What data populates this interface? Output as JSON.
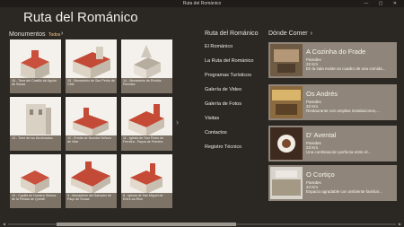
{
  "window": {
    "title": "Ruta del Románico",
    "controls": "— ▢ ✕"
  },
  "app_title": "Ruta del Románico",
  "monumentos": {
    "heading": "Monumentos",
    "filter": "Todos",
    "chevron": "›",
    "tiles": [
      {
        "caption": "16 - Torre del Castillo de Aguiar de Sousa"
      },
      {
        "caption": "15 - Monasterio de San Pedro de Cête"
      },
      {
        "caption": "14 - Monasterio de Ermida - Paredes"
      },
      {
        "caption": "13 - Torre de los Alcoforados"
      },
      {
        "caption": "12 - Ermita de Nuestra Señora de Vilar"
      },
      {
        "caption": "11 - Iglesia de San Pedro de Ferreira - Paços de Ferreira"
      },
      {
        "caption": "10 - Capilla de Nuestra Señora de la Piedad de Quintã"
      },
      {
        "caption": "9 - Monasterio del Salvador de Paço de Sousa"
      },
      {
        "caption": "8 - Iglesia de San Miguel de Entre-os-Rios"
      }
    ]
  },
  "next_arrow": "›",
  "menu": {
    "heading": "Ruta del Románico",
    "items": [
      "El Románico",
      "La Ruta del Románico",
      "Programas Turísticos",
      "Galería de Video",
      "Galería de Fotos",
      "Visitas",
      "Contactos",
      "Registro Técnico"
    ]
  },
  "donde_comer": {
    "heading": "Dónde Comer",
    "chevron": "›",
    "cards": [
      {
        "name": "A Cozinha do Frade",
        "location": "Paredes",
        "distance": "22 Km",
        "description": "En la sala existe un cuadro de una comida..."
      },
      {
        "name": "Os Andrés",
        "location": "Paredes",
        "distance": "22 Km",
        "description": "Restaurante con amplias instalaciones,..."
      },
      {
        "name": "D' Avental",
        "location": "Paredes",
        "distance": "23 Km",
        "description": "Una combinación perfecta entre el..."
      },
      {
        "name": "O Cortiço",
        "location": "Paredes",
        "distance": "24 Km",
        "description": "Espacio agradable con ambiente familiar..."
      }
    ]
  },
  "scrollbar": {
    "left_arrow": "◀",
    "right_arrow": "▶"
  }
}
